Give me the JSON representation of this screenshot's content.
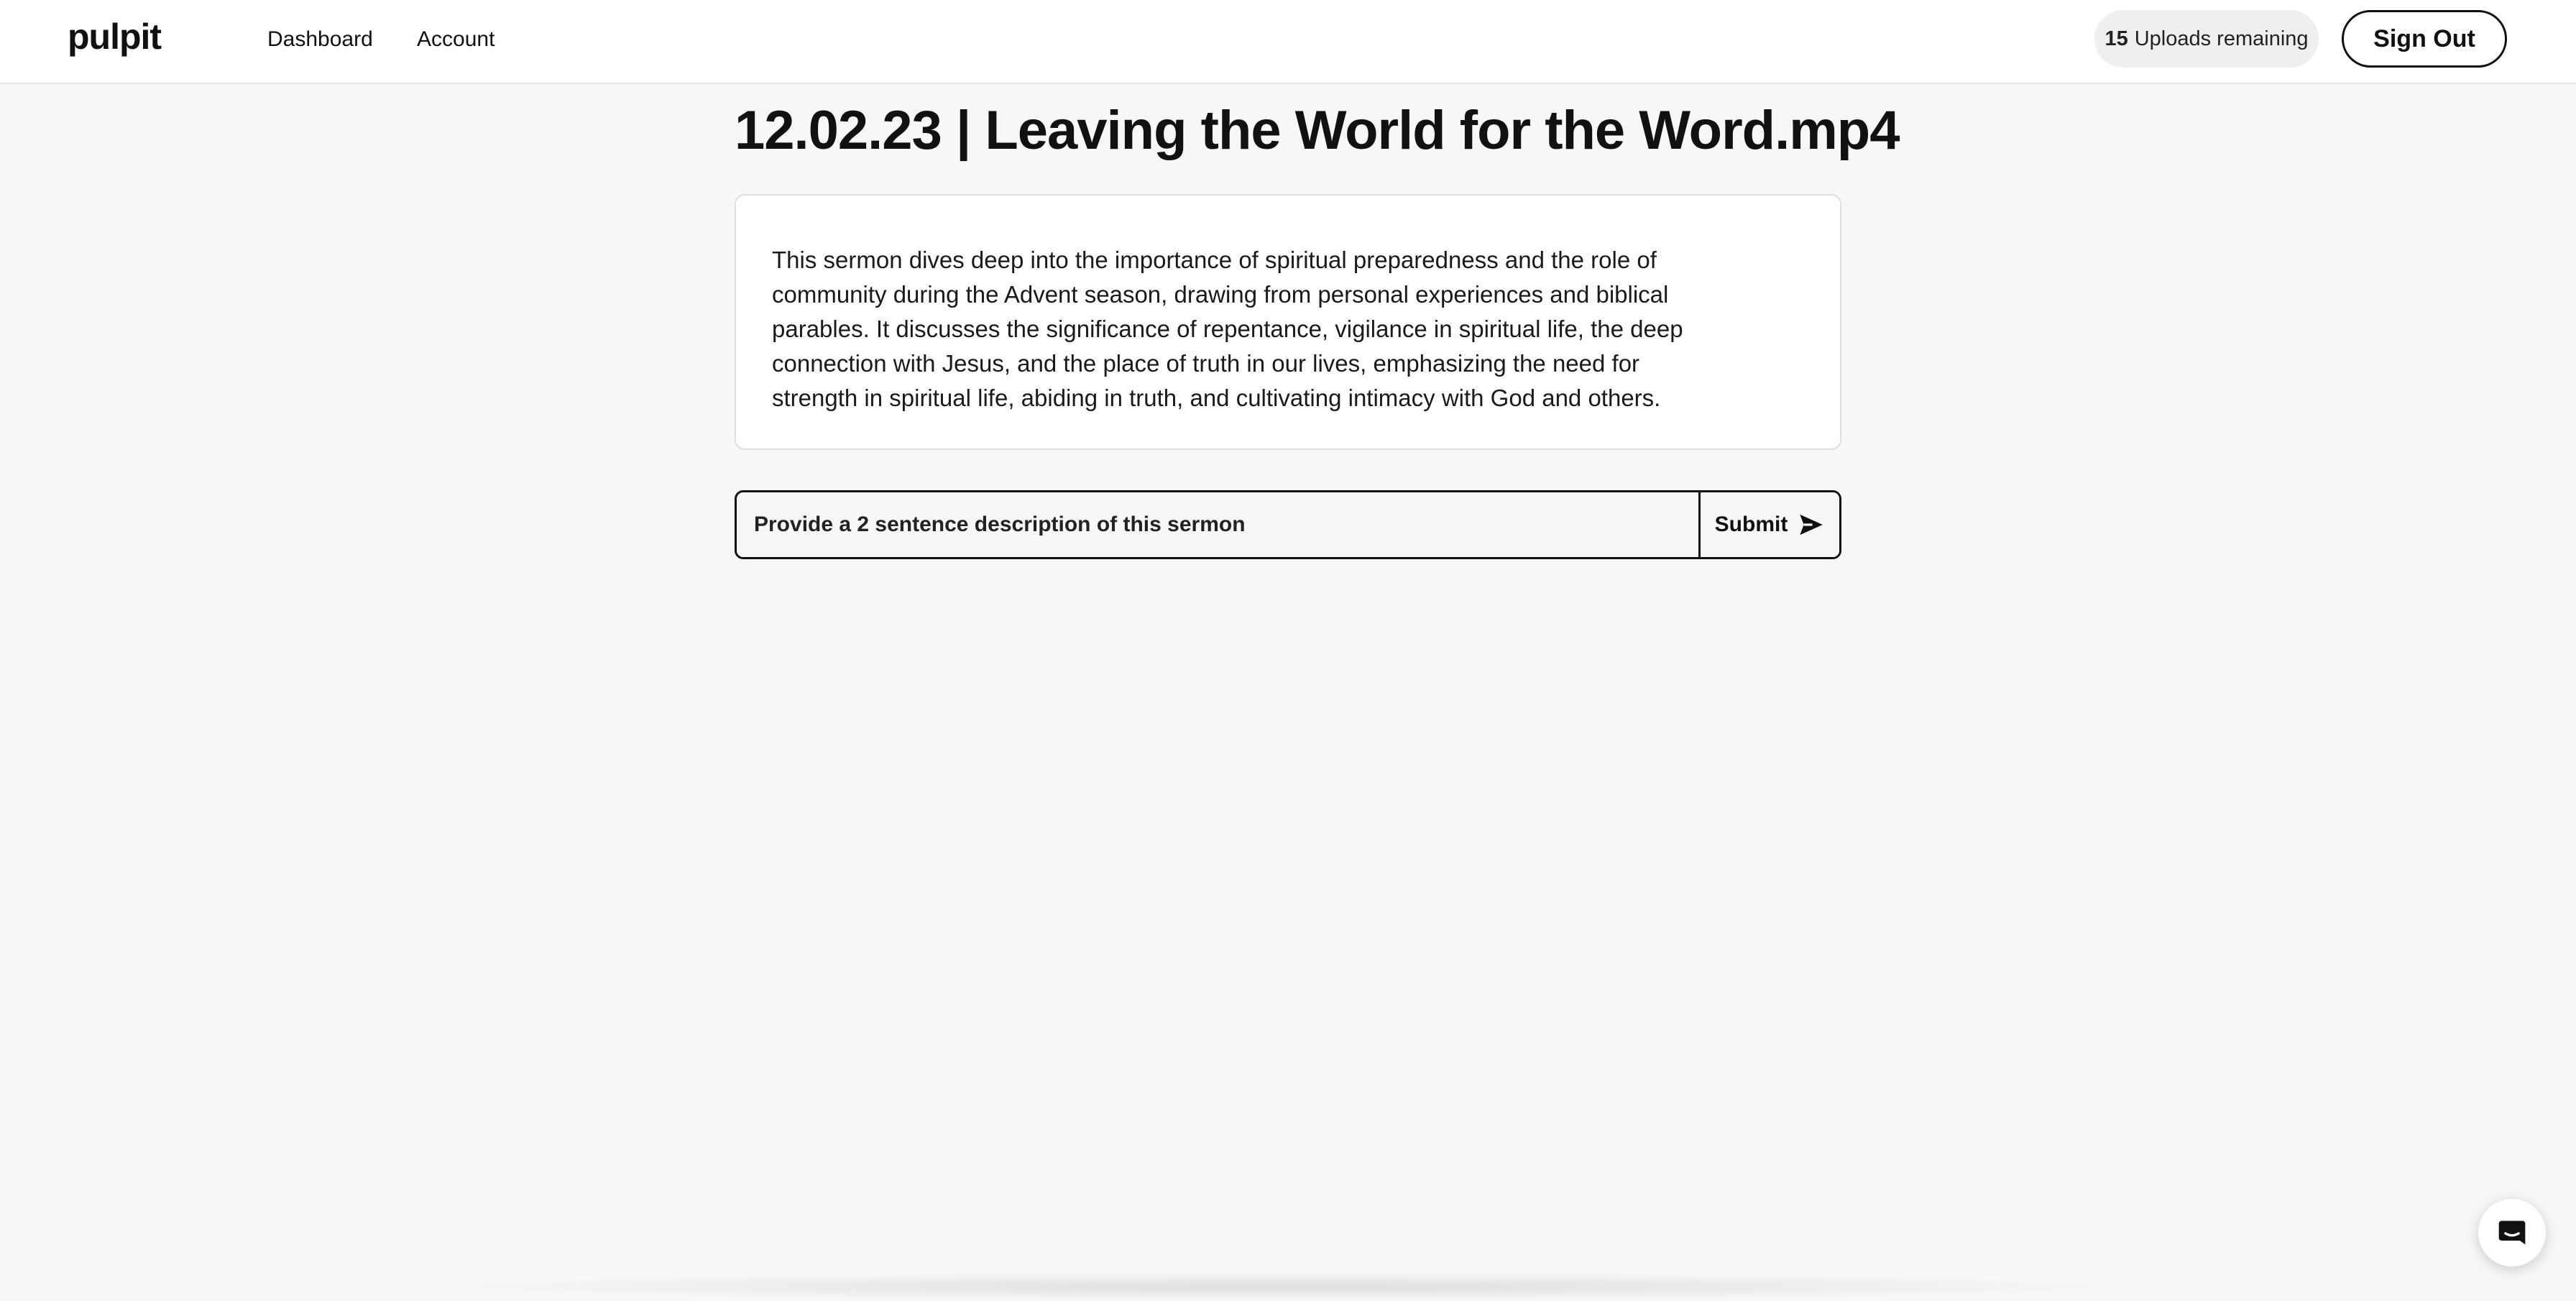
{
  "header": {
    "logo_text": "pulpit",
    "nav": [
      {
        "label": "Dashboard"
      },
      {
        "label": "Account"
      }
    ],
    "uploads_count": "15",
    "uploads_label": "Uploads remaining",
    "signout_label": "Sign Out"
  },
  "main": {
    "title": "12.02.23 | Leaving the World for the Word.mp4",
    "description": "This sermon dives deep into the importance of spiritual preparedness and the role of community during the Advent season, drawing from personal experiences and biblical parables. It discusses the significance of repentance, vigilance in spiritual life, the deep connection with Jesus, and the place of truth in our lives, emphasizing the need for strength in spiritual life, abiding in truth, and cultivating intimacy with God and others.",
    "prompt": {
      "value": "Provide a 2 sentence description of this sermon",
      "submit_label": "Submit"
    }
  },
  "icons": {
    "send": "send-icon",
    "chat": "chat-icon"
  },
  "colors": {
    "page_bg": "#f7f7f7",
    "text": "#111111",
    "pill_bg": "#efefef"
  }
}
